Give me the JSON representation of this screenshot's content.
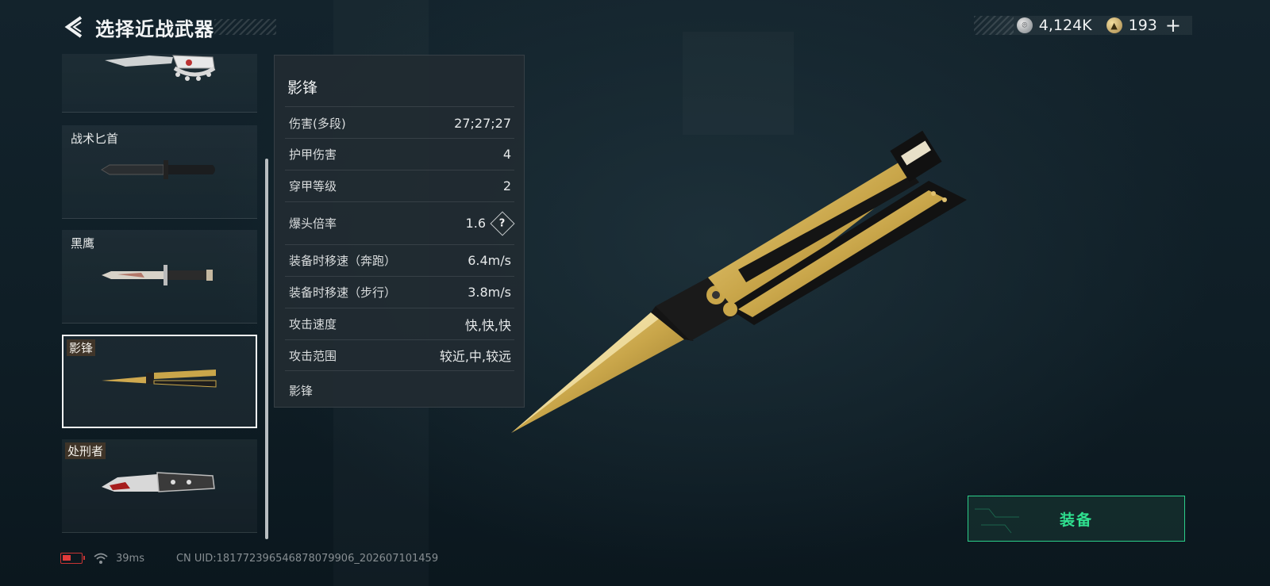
{
  "header": {
    "title": "选择近战武器"
  },
  "currency": [
    {
      "icon": "silver-coin-icon",
      "value": "4,124K"
    },
    {
      "icon": "gold-coin-icon",
      "value": "193"
    }
  ],
  "currency_plus": "+",
  "weapons": [
    {
      "name": "",
      "icon": "knuckle-knife-thumbnail"
    },
    {
      "name": "战术匕首",
      "icon": "tactical-dagger-thumbnail"
    },
    {
      "name": "黑鹰",
      "icon": "black-hawk-knife-thumbnail"
    },
    {
      "name": "影锋",
      "icon": "butterfly-knife-thumbnail",
      "selected": true
    },
    {
      "name": "处刑者",
      "icon": "executioner-knife-thumbnail"
    }
  ],
  "stats": {
    "title": "影锋",
    "rows": [
      {
        "label": "伤害(多段)",
        "value": "27;27;27"
      },
      {
        "label": "护甲伤害",
        "value": "4"
      },
      {
        "label": "穿甲等级",
        "value": "2"
      },
      {
        "label": "爆头倍率",
        "value": "1.6",
        "help": "?"
      },
      {
        "label": "装备时移速（奔跑）",
        "value": "6.4m/s"
      },
      {
        "label": "装备时移速（步行）",
        "value": "3.8m/s"
      },
      {
        "label": "攻击速度",
        "value": "快,快,快"
      },
      {
        "label": "攻击范围",
        "value": "较近,中,较远"
      }
    ],
    "description": "影锋"
  },
  "equip": {
    "label": "装备"
  },
  "footer": {
    "ping": "39ms",
    "uid": "CN UID:18177239654687807990​6_202607101459"
  },
  "colors": {
    "accent": "#2fe08f",
    "gold": "#c9a64a",
    "battery": "#e23b3b"
  }
}
